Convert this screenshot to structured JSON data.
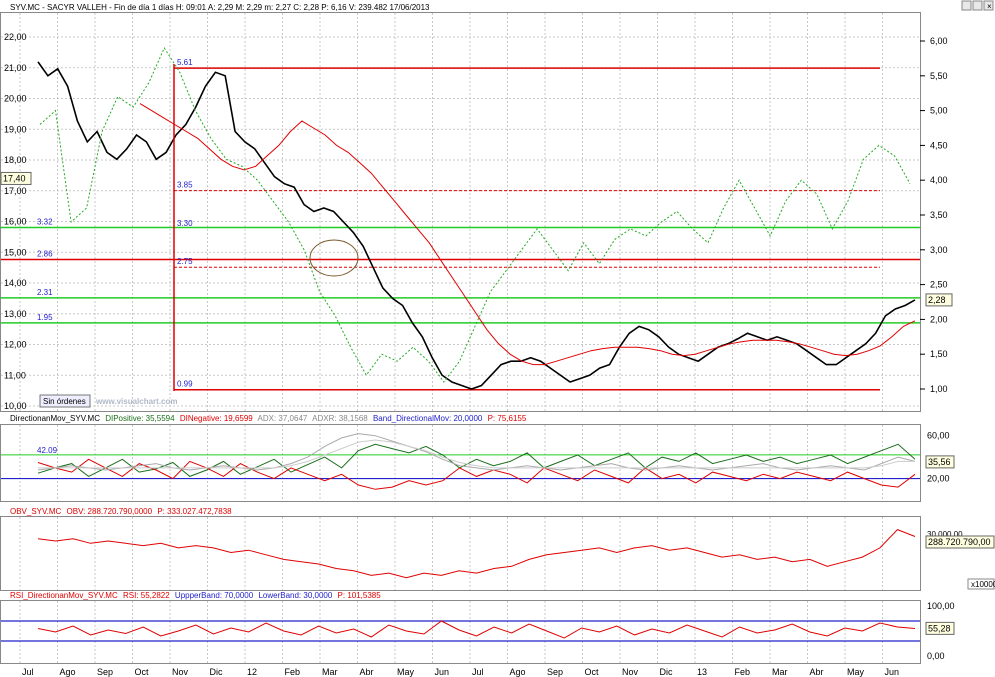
{
  "header": "SYV.MC - SACYR VALLEH - Fin de día 1 días H: 09:01 A: 2,29 M: 2,29 m: 2,27 C: 2,28 P: 6,16 V: 239.482 17/06/2013",
  "colors": {
    "price": "#000000",
    "ma": "#e00000",
    "dashed_green": "#22aa22",
    "level_red": "#e00000",
    "level_green": "#22cc22",
    "blue": "#2222cc",
    "grid": "#c8c8c8",
    "dark_green": "#1a6e1a"
  },
  "chart_data": [
    {
      "type": "line",
      "panel": "price",
      "yticks_left": [
        "22,00",
        "21,00",
        "20,00",
        "19,00",
        "18,00",
        "17,00",
        "16,00",
        "15,00",
        "14,00",
        "13,00",
        "12,00",
        "11,00",
        "10,00"
      ],
      "yticks_right": [
        "6,00",
        "5,50",
        "5,00",
        "4,50",
        "4,00",
        "3,50",
        "3,00",
        "2,50",
        "2,00",
        "1,50",
        "1,00"
      ],
      "last_left": "17,40",
      "last_right": "2,28",
      "levels": [
        {
          "label": "5.61",
          "value": 5.61,
          "style": "red-solid"
        },
        {
          "label": "3.85",
          "value": 3.85,
          "style": "red-dashed"
        },
        {
          "label": "3.32",
          "value": 3.32,
          "style": "green-solid"
        },
        {
          "label": "3.30",
          "value": 3.3,
          "style": "label-only"
        },
        {
          "label": "2.86",
          "value": 2.86,
          "style": "red-solid"
        },
        {
          "label": "2.75",
          "value": 2.75,
          "style": "red-dashed"
        },
        {
          "label": "2.31",
          "value": 2.31,
          "style": "green-solid"
        },
        {
          "label": "1.95",
          "value": 1.95,
          "style": "green-solid"
        },
        {
          "label": "0.99",
          "value": 0.99,
          "style": "red-solid"
        }
      ],
      "series": [
        {
          "values": [
            5.7,
            5.5,
            5.6,
            5.35,
            4.85,
            4.55,
            4.7,
            4.4,
            4.3,
            4.45,
            4.65,
            4.55,
            4.3,
            4.4,
            4.65,
            4.8,
            5.05,
            5.35,
            5.55,
            5.5,
            4.7,
            4.55,
            4.45,
            4.25,
            4.05,
            3.95,
            3.9,
            3.65,
            3.55,
            3.6,
            3.55,
            3.4,
            3.25,
            3.05,
            2.75,
            2.45,
            2.3,
            2.2,
            1.95,
            1.75,
            1.45,
            1.2,
            1.1,
            1.05,
            1.0,
            1.05,
            1.2,
            1.35,
            1.4,
            1.4,
            1.45,
            1.4,
            1.3,
            1.2,
            1.1,
            1.15,
            1.2,
            1.3,
            1.35,
            1.6,
            1.8,
            1.9,
            1.85,
            1.75,
            1.6,
            1.5,
            1.45,
            1.4,
            1.5,
            1.6,
            1.65,
            1.72,
            1.8,
            1.75,
            1.7,
            1.75,
            1.7,
            1.65,
            1.55,
            1.45,
            1.35,
            1.35,
            1.45,
            1.55,
            1.65,
            1.8,
            2.05,
            2.15,
            2.2,
            2.28
          ]
        },
        {
          "values": [
            5.1,
            5.0,
            4.9,
            4.8,
            4.7,
            4.6,
            4.45,
            4.3,
            4.2,
            4.15,
            4.2,
            4.35,
            4.5,
            4.7,
            4.85,
            4.75,
            4.65,
            4.5,
            4.4,
            4.25,
            4.1,
            3.9,
            3.7,
            3.5,
            3.3,
            3.1,
            2.85,
            2.6,
            2.35,
            2.1,
            1.85,
            1.65,
            1.5,
            1.4,
            1.35,
            1.35,
            1.4,
            1.45,
            1.5,
            1.55,
            1.58,
            1.6,
            1.6,
            1.6,
            1.58,
            1.55,
            1.5,
            1.48,
            1.5,
            1.55,
            1.6,
            1.65,
            1.68,
            1.7,
            1.7,
            1.7,
            1.68,
            1.65,
            1.6,
            1.55,
            1.5,
            1.48,
            1.5,
            1.55,
            1.62,
            1.75,
            1.9,
            1.98
          ]
        },
        {
          "values": [
            4.8,
            5.0,
            3.4,
            3.6,
            4.7,
            5.2,
            5.05,
            5.4,
            5.9,
            5.55,
            5.0,
            4.6,
            4.3,
            4.2,
            4.0,
            3.7,
            3.4,
            3.0,
            2.4,
            2.05,
            1.6,
            1.2,
            1.5,
            1.4,
            1.6,
            1.4,
            1.1,
            1.4,
            1.9,
            2.4,
            2.7,
            3.0,
            3.3,
            3.0,
            2.7,
            3.1,
            2.8,
            3.15,
            3.3,
            3.2,
            3.4,
            3.55,
            3.3,
            3.1,
            3.6,
            4.0,
            3.6,
            3.2,
            3.7,
            4.0,
            3.8,
            3.3,
            3.7,
            4.3,
            4.5,
            4.35,
            3.95
          ]
        }
      ]
    },
    {
      "type": "line",
      "panel": "directional",
      "legend": [
        "DirectionanMov_SYV.MC",
        "DIPositive: 35,5594",
        "DINegative: 19,6599",
        "ADX: 37,0647",
        "ADXR: 38,1568",
        "Band_DirectionalMov: 20,0000",
        "P: 75,6155"
      ],
      "yticks": [
        "60,00",
        "20,00"
      ],
      "last": "35,56",
      "band_label": "42.09",
      "band": 42.09,
      "lower": 20,
      "series": [
        {
          "values": [
            25,
            30,
            34,
            22,
            30,
            38,
            26,
            29,
            35,
            22,
            28,
            36,
            24,
            31,
            38,
            26,
            33,
            40,
            30,
            46,
            52,
            48,
            44,
            50,
            42,
            30,
            38,
            32,
            36,
            44,
            30,
            36,
            42,
            32,
            38,
            44,
            30,
            40,
            36,
            44,
            34,
            38,
            42,
            36,
            40,
            34,
            38,
            42,
            34,
            40,
            46,
            52,
            38
          ]
        },
        {
          "values": [
            35,
            30,
            26,
            38,
            30,
            22,
            34,
            28,
            20,
            36,
            30,
            22,
            34,
            26,
            20,
            30,
            24,
            18,
            24,
            14,
            10,
            12,
            18,
            14,
            18,
            30,
            22,
            28,
            24,
            16,
            30,
            24,
            18,
            28,
            22,
            16,
            30,
            20,
            24,
            16,
            26,
            22,
            18,
            24,
            20,
            26,
            22,
            18,
            26,
            20,
            14,
            12,
            24
          ]
        },
        {
          "values": [
            28,
            30,
            32,
            30,
            28,
            30,
            32,
            34,
            30,
            28,
            30,
            32,
            30,
            28,
            30,
            34,
            40,
            50,
            58,
            62,
            60,
            55,
            50,
            45,
            38,
            32,
            30,
            28,
            30,
            32,
            30,
            28,
            30,
            32,
            34,
            30,
            28,
            30,
            32,
            30,
            28,
            30,
            32,
            34,
            30,
            28,
            30,
            32,
            30,
            28,
            34,
            40,
            36
          ]
        },
        {
          "values": [
            30,
            30,
            30,
            30,
            30,
            30,
            30,
            30,
            30,
            30,
            30,
            30,
            30,
            30,
            30,
            32,
            36,
            42,
            48,
            54,
            56,
            54,
            50,
            46,
            40,
            35,
            32,
            30,
            30,
            30,
            30,
            30,
            30,
            30,
            30,
            30,
            30,
            30,
            30,
            30,
            30,
            30,
            30,
            30,
            30,
            30,
            30,
            30,
            30,
            30,
            32,
            36,
            36
          ]
        }
      ]
    },
    {
      "type": "line",
      "panel": "obv",
      "legend": [
        "OBV_SYV.MC",
        "OBV: 288.720.790,0000",
        "P: 333.027.472,7838"
      ],
      "ytick": "30,000,00",
      "last": "288.720.790,00",
      "scale": "x10000",
      "values": [
        18,
        17,
        18,
        16,
        17,
        16,
        15,
        16,
        14,
        15,
        14,
        12,
        13,
        11,
        9,
        8,
        7,
        5,
        4,
        2,
        3,
        1,
        3,
        2,
        4,
        3,
        5,
        6,
        9,
        11,
        12,
        13,
        14,
        12,
        14,
        15,
        13,
        14,
        12,
        10,
        11,
        9,
        10,
        8,
        9,
        6,
        8,
        10,
        14,
        22,
        19
      ]
    },
    {
      "type": "line",
      "panel": "rsi",
      "legend": [
        "RSI_DirectionanMov_SYV.MC",
        "RSI: 55,2822",
        "UppperBand: 70,0000",
        "LowerBand: 30,0000",
        "P: 101,5385"
      ],
      "yticks": [
        "100,00",
        "0,00"
      ],
      "last": "55,28",
      "upper": 70,
      "lower": 30,
      "values": [
        55,
        48,
        60,
        42,
        52,
        45,
        58,
        40,
        50,
        62,
        44,
        56,
        48,
        66,
        50,
        42,
        60,
        46,
        54,
        38,
        62,
        50,
        44,
        70,
        52,
        40,
        58,
        46,
        64,
        50,
        36,
        56,
        48,
        60,
        42,
        54,
        46,
        62,
        50,
        38,
        58,
        46,
        52,
        64,
        48,
        40,
        56,
        50,
        66,
        58,
        55
      ]
    }
  ],
  "xaxis": [
    "Jul",
    "Ago",
    "Sep",
    "Oct",
    "Nov",
    "Dic",
    "12",
    "Feb",
    "Mar",
    "Abr",
    "May",
    "Jun",
    "Jul",
    "Ago",
    "Sep",
    "Oct",
    "Nov",
    "Dic",
    "13",
    "Feb",
    "Mar",
    "Abr",
    "May",
    "Jun"
  ],
  "status_label": "Sin órdenes",
  "watermark": "www.visualchart.com"
}
